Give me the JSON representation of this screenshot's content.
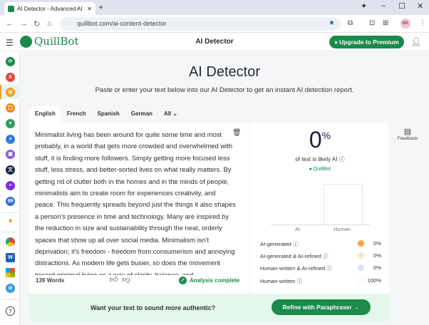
{
  "browser": {
    "tab_title": "AI Detector - Advanced AI Ch",
    "url": "quillbot.com/ai-content-detector",
    "avatar": "KK"
  },
  "header": {
    "logo": "QuillBot",
    "title": "AI Detector",
    "upgrade": "Upgrade to Premium"
  },
  "page": {
    "title": "AI Detector",
    "subtitle": "Paste or enter your text below into our AI Detector to get an instant AI detection report."
  },
  "languages": [
    "English",
    "French",
    "Spanish",
    "German",
    "All"
  ],
  "editor": {
    "text": "Minimalist living has been around for quite some time and most probably, in a world that gets more crowded and overwhelmed with stuff, it is finding more followers. Simply getting more focused less stuff, less stress, and better-sorted lives on what really matters. By getting rid of clutter both in the homes and in the minds of people, minimalists aim to create room for experiences creativity, and peace. This frequently spreads beyond just the things it also shapes a person's presence in time and technology. Many are inspired by the reduction in size and sustainability through the neat, orderly spaces that show up all over social media. Minimalism isn't deprivation; it's freedom - freedom from consumerism and annoying distractions. As modern life gets busier, so does the movement toward minimal living as a way of clarity, balance, and",
    "word_count": "139 Words",
    "status": "Analysis complete"
  },
  "results": {
    "percent": "0",
    "percent_sign": "%",
    "caption": "of text is likely AI",
    "brand": "QuillBot",
    "x_labels": [
      "AI",
      "Human"
    ],
    "legend": [
      {
        "label": "AI-generated",
        "value": "0%",
        "color": "#f5a93b"
      },
      {
        "label": "AI-generated & AI-refined",
        "value": "0%",
        "color": "#f6e7c8"
      },
      {
        "label": "Human-written & AI-refined",
        "value": "0%",
        "color": "#d9e2f7"
      },
      {
        "label": "Human-written",
        "value": "100%",
        "color": "#ffffff"
      }
    ]
  },
  "cta": {
    "question": "Want your text to sound more authentic?",
    "button": "Refine with Paraphraser"
  },
  "feedback": "Feedback"
}
